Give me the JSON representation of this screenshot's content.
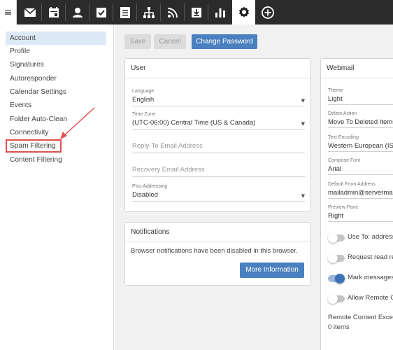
{
  "topbar": {
    "menu_icon": "hamburger-icon",
    "icons": [
      "mail-icon",
      "calendar-icon",
      "contacts-icon",
      "tasks-icon",
      "notes-icon",
      "sitemap-icon",
      "rss-icon",
      "download-icon",
      "reports-icon",
      "settings-icon",
      "add-icon"
    ],
    "active_icon": "settings-icon"
  },
  "sidebar": {
    "items": [
      {
        "label": "Account"
      },
      {
        "label": "Profile"
      },
      {
        "label": "Signatures"
      },
      {
        "label": "Autoresponder"
      },
      {
        "label": "Calendar Settings"
      },
      {
        "label": "Events"
      },
      {
        "label": "Folder Auto-Clean"
      },
      {
        "label": "Connectivity"
      },
      {
        "label": "Spam Filtering"
      },
      {
        "label": "Content Filtering"
      }
    ],
    "selected": "Account",
    "highlighted": "Spam Filtering"
  },
  "toolbar": {
    "save_label": "Save",
    "cancel_label": "Cancel",
    "change_password_label": "Change Password"
  },
  "user_card": {
    "title": "User",
    "language_label": "Language",
    "language_value": "English",
    "timezone_label": "Time Zone",
    "timezone_value": "(UTC-06:00) Central Time (US & Canada)",
    "reply_to_placeholder": "Reply-To Email Address",
    "recovery_placeholder": "Recovery Email Address",
    "plus_label": "Plus Addressing",
    "plus_value": "Disabled"
  },
  "notifications_card": {
    "title": "Notifications",
    "message": "Browser notifications have been disabled in this browser.",
    "button_label": "More Information"
  },
  "webmail_card": {
    "title": "Webmail",
    "theme_label": "Theme",
    "theme_value": "Light",
    "delete_label": "Delete Action",
    "delete_value": "Move To Deleted Items",
    "encoding_label": "Text Encoding",
    "encoding_value": "Western European (ISO",
    "font_label": "Compose Font",
    "font_value": "Arial",
    "from_label": "Default From Address",
    "from_value": "mailadmin@serverma",
    "preview_label": "Preview Pane",
    "preview_value": "Right",
    "toggles": [
      {
        "label": "Use To: address",
        "on": false
      },
      {
        "label": "Request read re",
        "on": false
      },
      {
        "label": "Mark messages",
        "on": true
      },
      {
        "label": "Allow Remote C",
        "on": false
      }
    ],
    "exceptions_label": "Remote Content Excep",
    "exceptions_count": "0 items"
  },
  "colors": {
    "topbar": "#2b2b2b",
    "primary": "#4a80bf",
    "annotation": "#e05050",
    "selected_bg": "#dde9f5"
  }
}
